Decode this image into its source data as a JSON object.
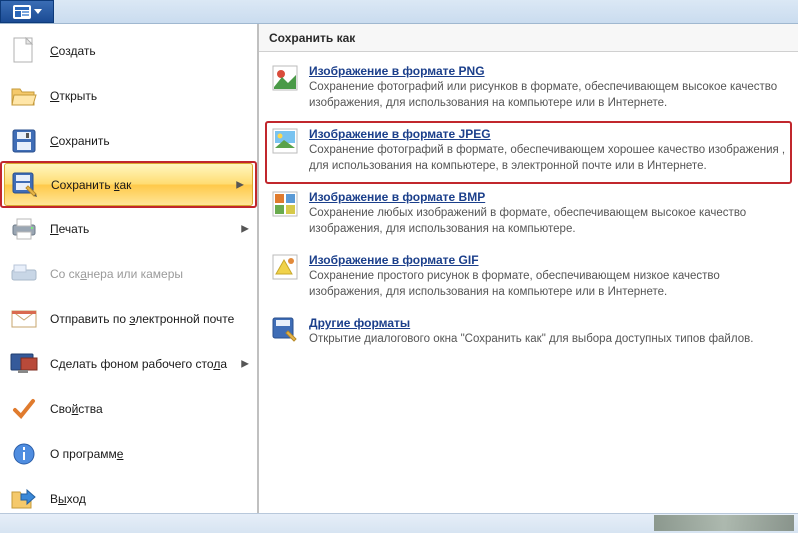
{
  "ribbon": {
    "app_button": "app-menu"
  },
  "menu": {
    "items": [
      {
        "label_pre": "",
        "key": "С",
        "label_post": "оздать"
      },
      {
        "label_pre": "",
        "key": "О",
        "label_post": "ткрыть"
      },
      {
        "label_pre": "",
        "key": "С",
        "label_post": "охранить"
      },
      {
        "label_pre": "Сохранить ",
        "key": "к",
        "label_post": "ак"
      },
      {
        "label_pre": "",
        "key": "П",
        "label_post": "ечать"
      },
      {
        "label_pre": "Со ск",
        "key": "а",
        "label_post": "нера или камеры"
      },
      {
        "label_pre": "Отправить по ",
        "key": "э",
        "label_post": "лектронной почте"
      },
      {
        "label_pre": "Сделать фоном рабочего сто",
        "key": "л",
        "label_post": "а"
      },
      {
        "label_pre": "Сво",
        "key": "й",
        "label_post": "ства"
      },
      {
        "label_pre": "О программ",
        "key": "е",
        "label_post": ""
      },
      {
        "label_pre": "В",
        "key": "ы",
        "label_post": "ход"
      }
    ]
  },
  "panel": {
    "header": "Сохранить как",
    "formats": [
      {
        "title_pre": "Изображение в формате ",
        "title_key": "P",
        "title_post": "NG",
        "desc": "Сохранение фотографий или рисунков в формате, обеспечивающем высокое качество изображения, для использования на компьютере или в Интернете."
      },
      {
        "title_pre": "Изобра",
        "title_key": "ж",
        "title_post": "ение в формате JPEG",
        "desc": "Сохранение фотографий в формате, обеспечивающем хорошее качество изображения , для использования на компьютере, в электронной почте или в Интернете."
      },
      {
        "title_pre": "Изображение в формате ",
        "title_key": "B",
        "title_post": "MP",
        "desc": "Сохранение любых изображений в формате, обеспечивающем высокое качество изображения, для использования на компьютере."
      },
      {
        "title_pre": "И",
        "title_key": "з",
        "title_post": "ображение в формате GIF",
        "desc": "Сохранение простого рисунок в формате, обеспечивающем низкое качество изображения, для использования на компьютере или в Интернете."
      },
      {
        "title_pre": "",
        "title_key": "Д",
        "title_post": "ругие форматы",
        "desc": "Открытие диалогового окна \"Сохранить как\" для выбора доступных типов файлов."
      }
    ]
  }
}
